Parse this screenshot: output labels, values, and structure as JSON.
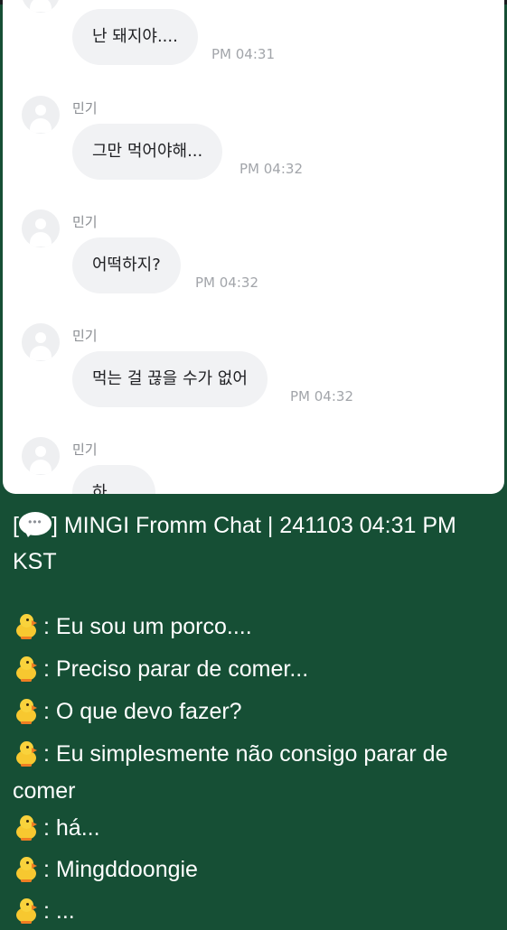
{
  "chat": {
    "messages": [
      {
        "sender": "",
        "text": "난 돼지야....",
        "time": "PM 04:31"
      },
      {
        "sender": "민기",
        "text": "그만 먹어야해...",
        "time": "PM 04:32"
      },
      {
        "sender": "민기",
        "text": "어떡하지?",
        "time": "PM 04:32"
      },
      {
        "sender": "민기",
        "text": "먹는 걸 끊을 수가 없어",
        "time": "PM 04:32"
      },
      {
        "sender": "민기",
        "text": "하",
        "time": ""
      }
    ]
  },
  "caption": {
    "title_open": "[",
    "title_text": "] MINGI Fromm Chat | 241103 04:31 PM KST",
    "lines": [
      ": Eu sou um porco....",
      ": Preciso parar de comer...",
      ": O que devo fazer?",
      ": Eu simplesmente não consigo parar de comer",
      ": há...",
      ": Mingddoongie",
      ": ..."
    ]
  },
  "icons": {
    "chat_icon": "speech-balloon-icon",
    "speaker_icon": "baby-chick-icon"
  },
  "colors": {
    "background": "#164f35",
    "bubble": "#f1f2f4",
    "timestamp": "#a2a5aa"
  }
}
